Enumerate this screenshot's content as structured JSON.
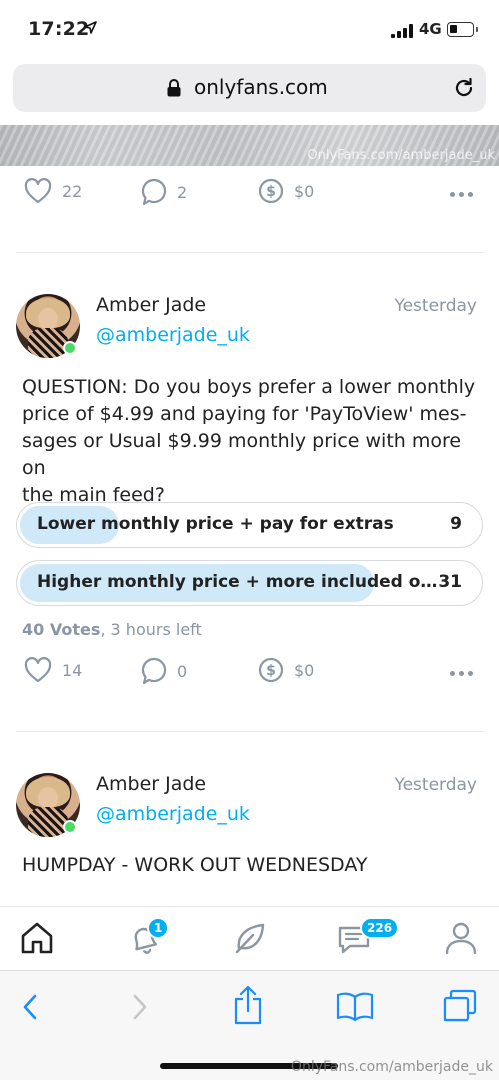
{
  "status_bar": {
    "time": "17:22",
    "network": "4G"
  },
  "browser": {
    "url": "onlyfans.com"
  },
  "media": {
    "watermark": "OnlyFans.com/amberjade_uk"
  },
  "post1_actions": {
    "likes": "22",
    "comments": "2",
    "tips": "$0"
  },
  "post2": {
    "author_name": "Amber Jade",
    "author_handle": "@amberjade_uk",
    "time": "Yesterday",
    "text_lines": [
      "QUESTION: Do you boys prefer a lower monthly",
      "price of $4.99 and paying for 'PayToView' mes-",
      "sages or Usual $9.99 monthly price with more on",
      "the main feed?"
    ],
    "poll": {
      "options": [
        {
          "label": "Lower monthly price + pay for extras",
          "votes": "9",
          "share": 0.225
        },
        {
          "label": "Higher monthly price + more included on main...",
          "votes": "31",
          "share": 0.775
        }
      ],
      "votes_label": "40 Votes",
      "time_left": ", 3 hours left"
    },
    "actions": {
      "likes": "14",
      "comments": "0",
      "tips": "$0"
    }
  },
  "post3": {
    "author_name": "Amber Jade",
    "author_handle": "@amberjade_uk",
    "time": "Yesterday",
    "text": "HUMPDAY - WORK OUT WEDNESDAY"
  },
  "tab_bar": {
    "notifications_badge": "1",
    "messages_badge": "226"
  },
  "footer": {
    "watermark": "OnlyFans.com/amberjade_uk"
  },
  "colors": {
    "accent": "#00aff0",
    "muted": "#8a96a3",
    "online": "#4cd964"
  }
}
